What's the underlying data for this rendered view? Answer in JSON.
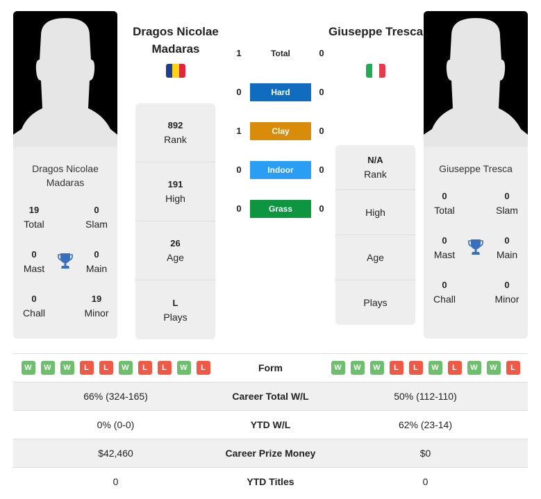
{
  "player1": {
    "name": "Dragos Nicolae Madaras",
    "card_name": "Dragos Nicolae Madaras",
    "flag": {
      "country": "Romania",
      "colors": [
        "#1c3f94",
        "#fcd116",
        "#e0263f"
      ]
    },
    "titles": {
      "total": {
        "value": "19",
        "label": "Total"
      },
      "slam": {
        "value": "0",
        "label": "Slam"
      },
      "mast": {
        "value": "0",
        "label": "Mast"
      },
      "main": {
        "value": "0",
        "label": "Main"
      },
      "chall": {
        "value": "0",
        "label": "Chall"
      },
      "minor": {
        "value": "19",
        "label": "Minor"
      }
    },
    "stats": [
      {
        "value": "892",
        "label": "Rank"
      },
      {
        "value": "191",
        "label": "High"
      },
      {
        "value": "26",
        "label": "Age"
      },
      {
        "value": "L",
        "label": "Plays"
      }
    ],
    "form": [
      "W",
      "W",
      "W",
      "L",
      "L",
      "W",
      "L",
      "L",
      "W",
      "L"
    ]
  },
  "player2": {
    "name": "Giuseppe Tresca",
    "card_name": "Giuseppe Tresca",
    "flag": {
      "country": "Italy",
      "colors": [
        "#1ead55",
        "#ffffff",
        "#e63b4a"
      ]
    },
    "titles": {
      "total": {
        "value": "0",
        "label": "Total"
      },
      "slam": {
        "value": "0",
        "label": "Slam"
      },
      "mast": {
        "value": "0",
        "label": "Mast"
      },
      "main": {
        "value": "0",
        "label": "Main"
      },
      "chall": {
        "value": "0",
        "label": "Chall"
      },
      "minor": {
        "value": "0",
        "label": "Minor"
      }
    },
    "stats": [
      {
        "value": "N/A",
        "label": "Rank"
      },
      {
        "value": "",
        "label": "High"
      },
      {
        "value": "",
        "label": "Age"
      },
      {
        "value": "",
        "label": "Plays"
      }
    ],
    "form": [
      "W",
      "W",
      "W",
      "L",
      "L",
      "W",
      "L",
      "W",
      "W",
      "L"
    ]
  },
  "h2h": [
    {
      "label": "Total",
      "left": "1",
      "right": "0",
      "color": ""
    },
    {
      "label": "Hard",
      "left": "0",
      "right": "0",
      "color": "#0f6cbf"
    },
    {
      "label": "Clay",
      "left": "1",
      "right": "0",
      "color": "#d98b0a"
    },
    {
      "label": "Indoor",
      "left": "0",
      "right": "0",
      "color": "#2a9df4"
    },
    {
      "label": "Grass",
      "left": "0",
      "right": "0",
      "color": "#0d963f"
    }
  ],
  "comparison": {
    "form_label": "Form",
    "rows": [
      {
        "label": "Career Total W/L",
        "left": "66% (324-165)",
        "right": "50% (112-110)"
      },
      {
        "label": "YTD W/L",
        "left": "0% (0-0)",
        "right": "62% (23-14)"
      },
      {
        "label": "Career Prize Money",
        "left": "$42,460",
        "right": "$0"
      },
      {
        "label": "YTD Titles",
        "left": "0",
        "right": "0"
      }
    ]
  }
}
